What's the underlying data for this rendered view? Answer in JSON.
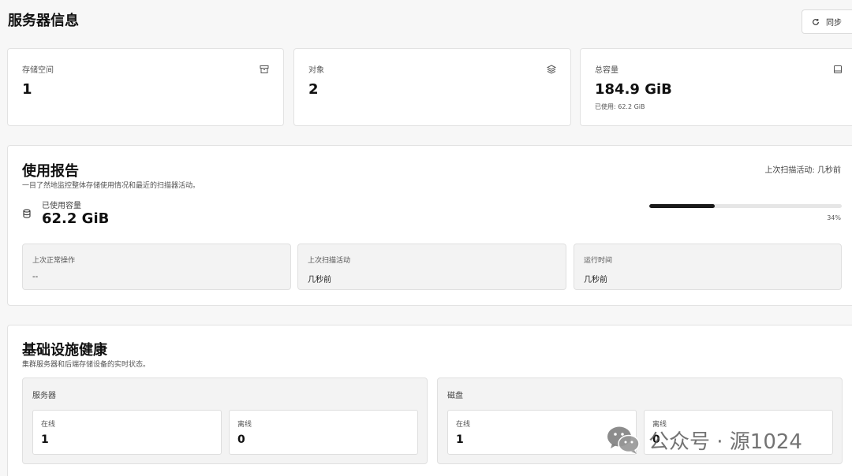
{
  "header": {
    "title": "服务器信息",
    "sync_label": "同步"
  },
  "stats": [
    {
      "label": "存储空间",
      "value": "1",
      "sub": "",
      "icon": "archive-icon"
    },
    {
      "label": "对象",
      "value": "2",
      "sub": "",
      "icon": "layers-icon"
    },
    {
      "label": "总容量",
      "value": "184.9 GiB",
      "sub": "已使用: 62.2 GiB",
      "icon": "drive-icon"
    }
  ],
  "usage": {
    "title": "使用报告",
    "description": "一目了然地监控整体存储使用情况和最近的扫描器活动。",
    "last_scan": "上次扫描活动: 几秒前",
    "used_label": "已使用容量",
    "used_value": "62.2 GiB",
    "percent": 34,
    "percent_label": "34%",
    "boxes": [
      {
        "label": "上次正常操作",
        "value": "--"
      },
      {
        "label": "上次扫描活动",
        "value": "几秒前"
      },
      {
        "label": "运行时间",
        "value": "几秒前"
      }
    ]
  },
  "infra": {
    "title": "基础设施健康",
    "description": "集群服务器和后端存储设备的实时状态。",
    "groups": [
      {
        "title": "服务器",
        "online_label": "在线",
        "online_value": "1",
        "offline_label": "离线",
        "offline_value": "0"
      },
      {
        "title": "磁盘",
        "online_label": "在线",
        "online_value": "1",
        "offline_label": "离线",
        "offline_value": "0"
      }
    ]
  },
  "watermark": {
    "text": "公众号 · 源1024",
    "icon": "wechat-icon"
  },
  "colors": {
    "progress_fill": "#1a1a1a",
    "progress_track": "#e6e6e6"
  }
}
